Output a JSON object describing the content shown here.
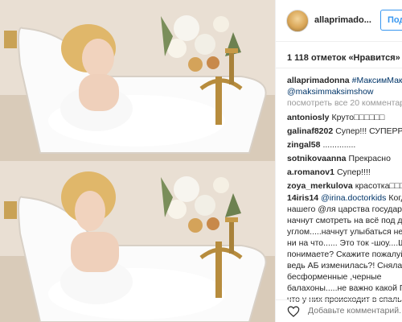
{
  "post": {
    "username": "allaprimado...",
    "follow_label": "Подпи",
    "likes": "1 118 отметок «Нравится»",
    "caption": {
      "username": "allaprimadonna",
      "text_line1": "#МаксимМакс",
      "text_line2": "@maksimmaksimshow"
    },
    "more_comments": "посмотреть все 20 комментар",
    "comments": [
      {
        "username": "antoniosly",
        "text": "Круто□□□□□□"
      },
      {
        "username": "galinaf8202",
        "text": "Супер!!! СУПЕРРR"
      },
      {
        "username": "zingal58",
        "text": ".............."
      },
      {
        "username": "sotnikovaanna",
        "text": "Прекрасно"
      },
      {
        "username": "a.romanov1",
        "text": "Супер!!!!"
      },
      {
        "username": "zoya_merkulova",
        "text": "красотка□□□"
      }
    ],
    "long_comment": {
      "username": "14iris14",
      "mention": "@irina.doctorkids",
      "text_first": "Когда",
      "lines": [
        "нашего @ля царства государст",
        "начнут смотреть на всё под д",
        "углом.....начнут улыбаться не",
        "ни на что......  Это ток -шоу....Ш",
        "понимаете? Скажите пожалуй",
        "ведь АБ изменилась?! Сняла с",
        "бесформенные ,черные",
        "балахоны.....не важно какой Га",
        "что у них происходит в спальн"
      ]
    },
    "add_comment_placeholder": "Добавьте комментарий..."
  },
  "colors": {
    "link": "#003569",
    "follow": "#3897f0",
    "muted": "#999999",
    "text": "#262626"
  }
}
